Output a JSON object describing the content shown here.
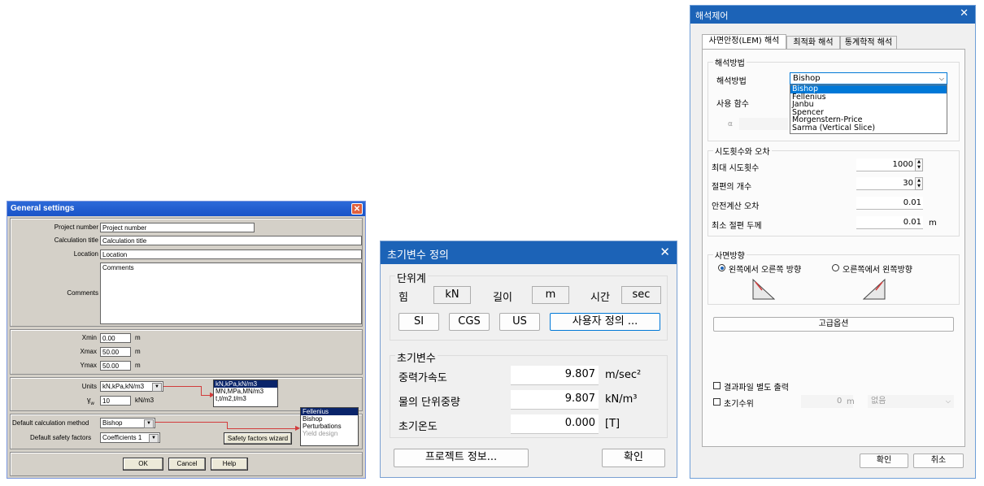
{
  "general_settings": {
    "title": "General settings",
    "close": "✕",
    "fields": [
      {
        "label": "Project number",
        "value": "Project number"
      },
      {
        "label": "Calculation title",
        "value": "Calculation title"
      },
      {
        "label": "Location",
        "value": "Location"
      }
    ],
    "comments_label": "Comments",
    "comments_value": "Comments",
    "coords": [
      {
        "label": "Xmin",
        "value": "0.00",
        "unit": "m"
      },
      {
        "label": "Xmax",
        "value": "50.00",
        "unit": "m"
      },
      {
        "label": "Ymax",
        "value": "50.00",
        "unit": "m"
      }
    ],
    "units_label": "Units",
    "units_value": "kN,kPa,kN/m3",
    "units_options": [
      "kN,kPa,kN/m3",
      "MN,MPa,MN/m3",
      "t,t/m2,t/m3"
    ],
    "yw_label": "γ",
    "yw_sub": "w",
    "yw_value": "10",
    "yw_unit": "kN/m3",
    "method_label": "Default calculation method",
    "method_value": "Bishop",
    "method_options": [
      "Fellenius",
      "Bishop",
      "Perturbations",
      "Yield design"
    ],
    "safety_label": "Default safety factors",
    "safety_value": "Coefficients  1",
    "wizard_button": "Safety factors wizard",
    "ok": "OK",
    "cancel": "Cancel",
    "help": "Help"
  },
  "initial_vars": {
    "title": "초기변수 정의",
    "close": "✕",
    "units_group": "단위계",
    "force_label": "힘",
    "force_value": "kN",
    "length_label": "길이",
    "length_value": "m",
    "time_label": "시간",
    "time_value": "sec",
    "btn_si": "SI",
    "btn_cgs": "CGS",
    "btn_us": "US",
    "btn_custom": "사용자 정의 ...",
    "vars_group": "초기변수",
    "vars": [
      {
        "label": "중력가속도",
        "value": "9.807",
        "unit": "m/sec²"
      },
      {
        "label": "물의 단위중량",
        "value": "9.807",
        "unit": "kN/m³"
      },
      {
        "label": "초기온도",
        "value": "0.000",
        "unit": "[T]"
      }
    ],
    "project_info": "프로젝트 정보...",
    "ok": "확인"
  },
  "analysis_control": {
    "title": "해석제어",
    "close": "✕",
    "tabs": [
      "사면안정(LEM) 해석",
      "최적화 해석",
      "통계학적 해석"
    ],
    "method_group": "해석방법",
    "method_label": "해석방법",
    "method_value": "Bishop",
    "method_options": [
      "Bishop",
      "Fellenius",
      "Janbu",
      "Spencer",
      "Morgenstern-Price",
      "Sarma (Vertical Slice)"
    ],
    "func_label": "사용 함수",
    "alpha_label": "α",
    "trials_group": "시도횟수와 오차",
    "trials": [
      {
        "label": "최대 시도횟수",
        "value": "1000",
        "unit": ""
      },
      {
        "label": "절편의 개수",
        "value": "30",
        "unit": ""
      },
      {
        "label": "안전계산 오차",
        "value": "0.01",
        "unit": ""
      },
      {
        "label": "최소 절편 두께",
        "value": "0.01",
        "unit": "m"
      }
    ],
    "direction_group": "사면방향",
    "dir_left": "왼쪽에서 오른쪽 방향",
    "dir_right": "오른쪽에서 왼쪽방향",
    "advanced": "고급옵션",
    "output_check": "결과파일 별도 출력",
    "water_check": "초기수위",
    "water_value": "0",
    "water_unit": "m",
    "water_select": "없음",
    "ok": "확인",
    "cancel": "취소"
  }
}
